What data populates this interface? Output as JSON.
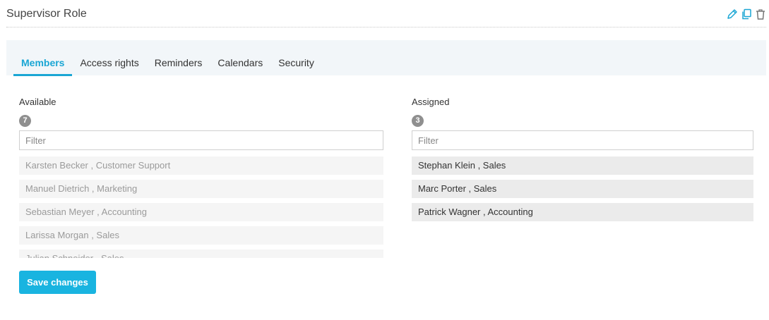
{
  "header": {
    "title": "Supervisor Role",
    "icons": [
      "edit-icon",
      "copy-icon",
      "trash-icon"
    ],
    "icon_color": "#1aa6d4"
  },
  "tabs": [
    {
      "label": "Members",
      "active": true
    },
    {
      "label": "Access rights",
      "active": false
    },
    {
      "label": "Reminders",
      "active": false
    },
    {
      "label": "Calendars",
      "active": false
    },
    {
      "label": "Security",
      "active": false
    }
  ],
  "available": {
    "label": "Available",
    "count": "7",
    "filter_placeholder": "Filter",
    "items": [
      "Karsten Becker , Customer Support",
      "Manuel Dietrich , Marketing",
      "Sebastian Meyer , Accounting",
      "Larissa Morgan , Sales",
      "Julian Schneider , Sales"
    ]
  },
  "assigned": {
    "label": "Assigned",
    "count": "3",
    "filter_placeholder": "Filter",
    "items": [
      "Stephan Klein , Sales",
      "Marc Porter , Sales",
      "Patrick Wagner , Accounting"
    ]
  },
  "actions": {
    "save_label": "Save changes"
  },
  "colors": {
    "accent": "#1aa6d4",
    "button": "#19b4e0",
    "tab_bar": "#f2f6f9"
  }
}
